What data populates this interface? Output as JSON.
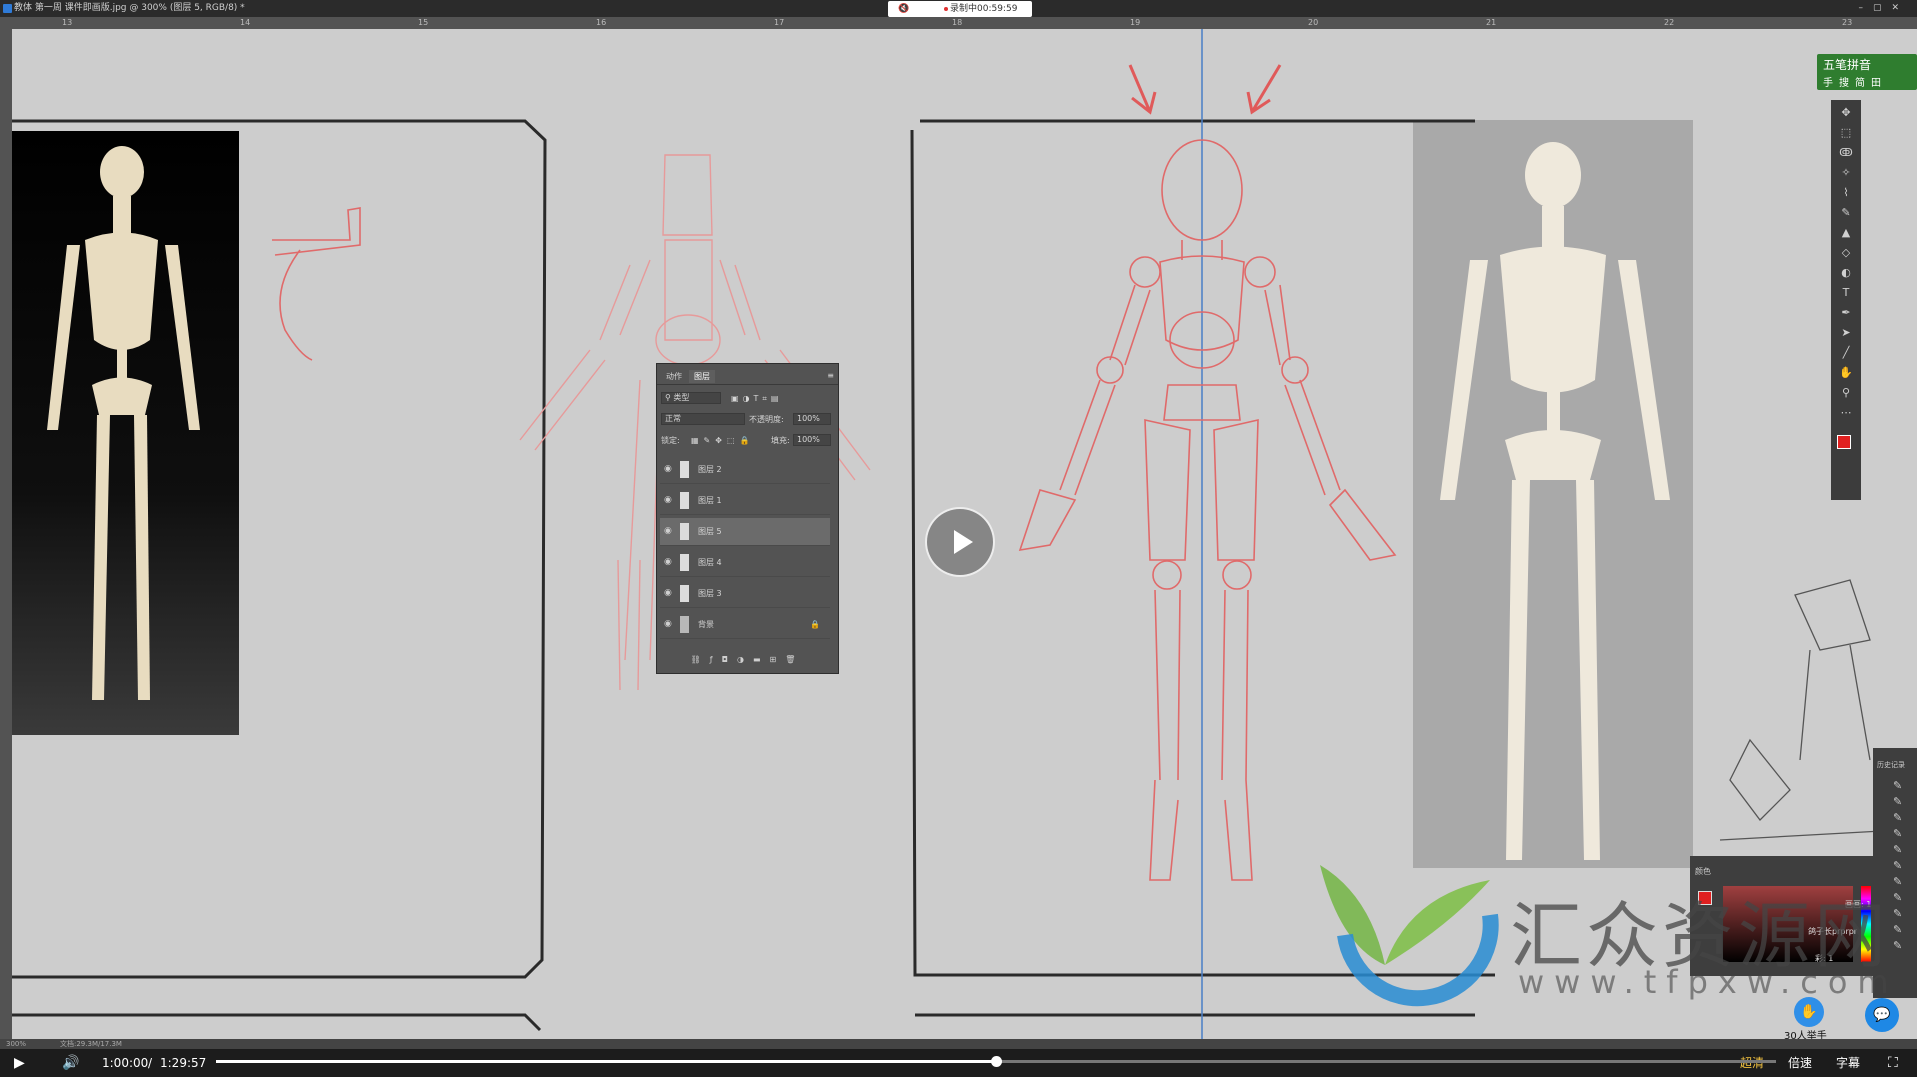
{
  "window": {
    "title": "教体 第一周 课件即画版.jpg @ 300% (图层 5, RGB/8) *",
    "recording_label": "录制中00:59:59",
    "buttons": [
      "–",
      "▢",
      "✕"
    ]
  },
  "ruler": {
    "ticks": [
      "13",
      "14",
      "15",
      "16",
      "17",
      "18",
      "19",
      "20",
      "21",
      "22",
      "23"
    ]
  },
  "ime_bar": {
    "label": "五笔拼音",
    "row2": [
      "手",
      "搜",
      "简",
      "田"
    ]
  },
  "layers_panel": {
    "tabs": [
      "动作",
      "图层"
    ],
    "active_tab": "图层",
    "filter_label": "类型",
    "blend_mode": "正常",
    "opacity_label": "不透明度:",
    "opacity_value": "100%",
    "lock_label": "锁定:",
    "fill_label": "填充:",
    "fill_value": "100%",
    "layers": [
      {
        "name": "图层 2",
        "selected": false
      },
      {
        "name": "图层 1",
        "selected": false
      },
      {
        "name": "图层 5",
        "selected": true
      },
      {
        "name": "图层 4",
        "selected": false
      },
      {
        "name": "图层 3",
        "selected": false
      },
      {
        "name": "背景",
        "selected": false,
        "locked": true
      }
    ],
    "footer_icons": [
      "link-icon",
      "fx-icon",
      "mask-icon",
      "adjustment-icon",
      "folder-icon",
      "new-layer-icon",
      "trash-icon"
    ]
  },
  "tools": [
    "move-icon",
    "marquee-icon",
    "lasso-icon",
    "magic-wand-icon",
    "eyedropper-icon",
    "brush-icon",
    "stamp-icon",
    "eraser-icon",
    "gradient-icon",
    "text-icon",
    "pen-icon",
    "selection-icon",
    "line-icon",
    "hand-icon",
    "zoom-icon",
    "more-icon"
  ],
  "history_panel": {
    "title": "历史记录"
  },
  "color_panel": {
    "title": "颜色",
    "side_labels": [
      "画画: 1",
      "鸽子长prprpr",
      "彩: 1"
    ],
    "overlay_text": "鸽子长prprpr"
  },
  "watermark": {
    "brand": "汇众资源网",
    "url": "www.tfpxw.com"
  },
  "raise_hand": {
    "label": "30人举手"
  },
  "statusbar": {
    "zoom": "300%",
    "doc": "文档:29.3M/17.3M"
  },
  "player": {
    "current_time": "1:00:00",
    "separator": "/",
    "duration": "1:29:57",
    "progress": 0.5,
    "quality_label": "超清",
    "speed_label": "倍速",
    "subtitle_label": "字幕"
  },
  "colors": {
    "accent_red": "#e05a5a",
    "guide_blue": "#4a7fc7",
    "ime_green": "#2f7d2f",
    "foreground_swatch": "#e02020"
  }
}
